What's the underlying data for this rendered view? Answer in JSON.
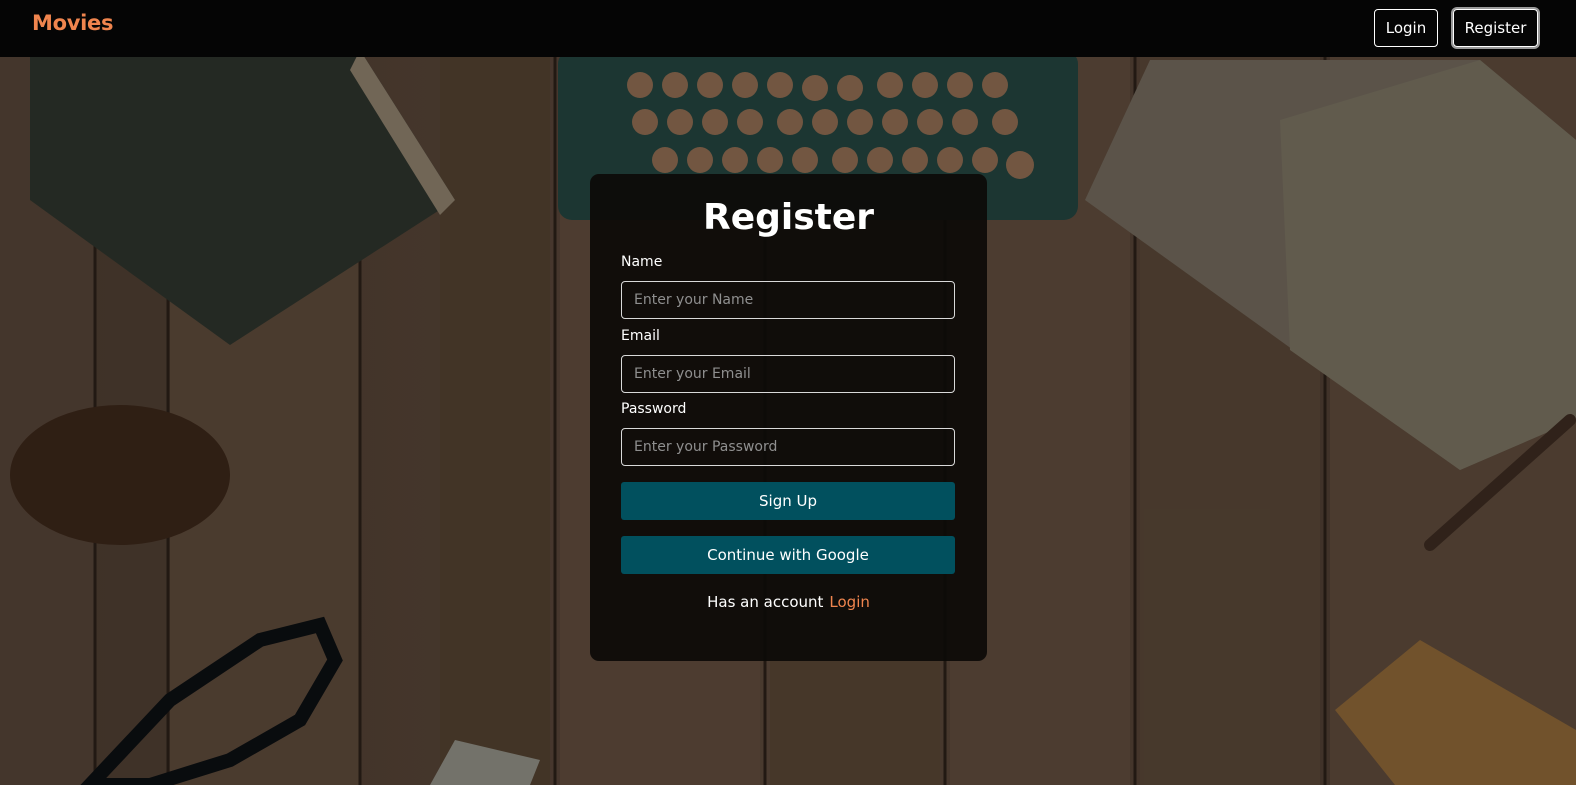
{
  "navbar": {
    "brand": "Movies",
    "login_label": "Login",
    "register_label": "Register"
  },
  "form": {
    "title": "Register",
    "name_label": "Name",
    "name_placeholder": "Enter your Name",
    "email_label": "Email",
    "email_placeholder": "Enter your Email",
    "password_label": "Password",
    "password_placeholder": "Enter your Password",
    "signup_label": "Sign Up",
    "google_label": "Continue with Google",
    "has_account_text": "Has an account",
    "login_link_label": "Login"
  },
  "colors": {
    "accent": "#f0854e",
    "button": "#01505e",
    "navbar": "#050505"
  }
}
